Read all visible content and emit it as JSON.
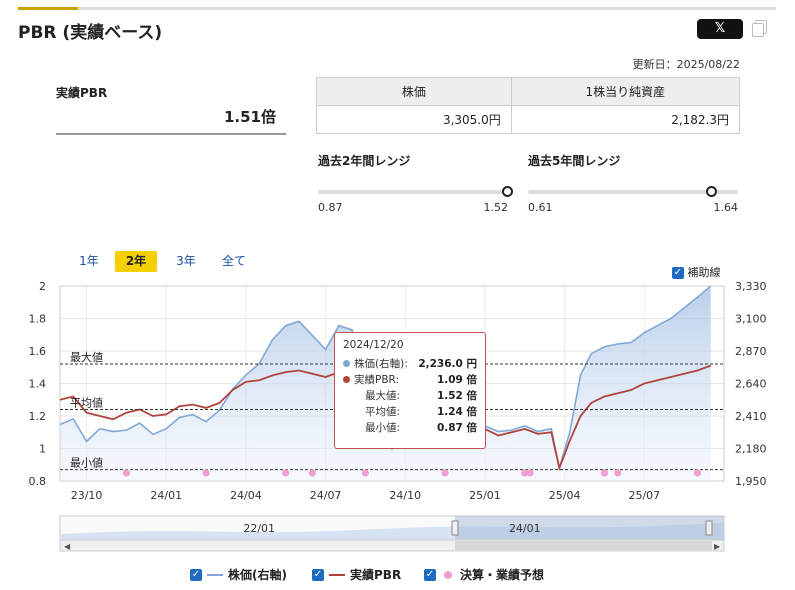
{
  "header": {
    "title": "PBR (実績ベース)",
    "share_label": "𝕏",
    "updated": "更新日：2025/08/22"
  },
  "pbr": {
    "label": "実績PBR",
    "value": "1.51倍"
  },
  "info_table": {
    "price_label": "株価",
    "bps_label": "1株当り純資産",
    "price_value": "3,305.0円",
    "bps_value": "2,182.3円"
  },
  "ranges": [
    {
      "title": "過去2年間レンジ",
      "min": "0.87",
      "max": "1.52",
      "position": 0.995
    },
    {
      "title": "過去5年間レンジ",
      "min": "0.61",
      "max": "1.64",
      "position": 0.87
    }
  ],
  "period_tabs": [
    {
      "label": "1年",
      "active": false
    },
    {
      "label": "2年",
      "active": true
    },
    {
      "label": "3年",
      "active": false
    },
    {
      "label": "全て",
      "active": false
    }
  ],
  "aux_label": "補助線",
  "colors": {
    "price": "#7fa8d8",
    "pbr": "#b0443c",
    "events": "#f0a0d0",
    "accent": "#f5d000",
    "checkbox": "#1e6bc1"
  },
  "chart_data": {
    "type": "line",
    "y_left": {
      "range": [
        0.8,
        2.0
      ],
      "ticks": [
        "0.8",
        "1",
        "1.2",
        "1.4",
        "1.6",
        "1.8",
        "2"
      ]
    },
    "y_right": {
      "range": [
        1950,
        3330
      ],
      "ticks": [
        "1,950",
        "2,180",
        "2,410",
        "2,640",
        "2,870",
        "3,100",
        "3,330"
      ]
    },
    "x_range": [
      0,
      25
    ],
    "x_ticks": [
      {
        "label": "23/10",
        "x": 1
      },
      {
        "label": "24/01",
        "x": 4
      },
      {
        "label": "24/04",
        "x": 7
      },
      {
        "label": "24/07",
        "x": 10
      },
      {
        "label": "24/10",
        "x": 13
      },
      {
        "label": "25/01",
        "x": 16
      },
      {
        "label": "25/04",
        "x": 19
      },
      {
        "label": "25/07",
        "x": 22
      }
    ],
    "reference_lines": [
      {
        "label": "最大値",
        "value": 1.52
      },
      {
        "label": "平均値",
        "value": 1.24
      },
      {
        "label": "最小値",
        "value": 0.87
      }
    ],
    "price_series": [
      [
        0,
        2350
      ],
      [
        0.5,
        2390
      ],
      [
        1,
        2230
      ],
      [
        1.5,
        2320
      ],
      [
        2,
        2300
      ],
      [
        2.5,
        2310
      ],
      [
        3,
        2360
      ],
      [
        3.5,
        2280
      ],
      [
        4,
        2320
      ],
      [
        4.5,
        2400
      ],
      [
        5,
        2420
      ],
      [
        5.5,
        2370
      ],
      [
        6,
        2450
      ],
      [
        6.5,
        2600
      ],
      [
        7,
        2700
      ],
      [
        7.5,
        2780
      ],
      [
        8,
        2950
      ],
      [
        8.5,
        3050
      ],
      [
        9,
        3080
      ],
      [
        9.5,
        2980
      ],
      [
        10,
        2880
      ],
      [
        10.5,
        3050
      ],
      [
        11,
        3020
      ],
      [
        11.5,
        2500
      ],
      [
        12,
        2260
      ],
      [
        12.5,
        2200
      ],
      [
        13,
        2270
      ],
      [
        13.5,
        2250
      ],
      [
        14,
        2300
      ],
      [
        14.5,
        2320
      ],
      [
        15,
        2350
      ],
      [
        15.5,
        2310
      ],
      [
        16,
        2340
      ],
      [
        16.5,
        2300
      ],
      [
        17,
        2310
      ],
      [
        17.5,
        2340
      ],
      [
        18,
        2300
      ],
      [
        18.5,
        2320
      ],
      [
        18.8,
        2040
      ],
      [
        19.2,
        2300
      ],
      [
        19.6,
        2700
      ],
      [
        20,
        2850
      ],
      [
        20.5,
        2900
      ],
      [
        21,
        2920
      ],
      [
        21.5,
        2930
      ],
      [
        22,
        3000
      ],
      [
        22.5,
        3050
      ],
      [
        23,
        3100
      ],
      [
        24,
        3250
      ],
      [
        24.5,
        3330
      ]
    ],
    "pbr_series": [
      [
        0,
        1.3
      ],
      [
        0.5,
        1.32
      ],
      [
        1,
        1.22
      ],
      [
        1.5,
        1.2
      ],
      [
        2,
        1.18
      ],
      [
        2.5,
        1.22
      ],
      [
        3,
        1.24
      ],
      [
        3.5,
        1.2
      ],
      [
        4,
        1.21
      ],
      [
        4.5,
        1.26
      ],
      [
        5,
        1.27
      ],
      [
        5.5,
        1.25
      ],
      [
        6,
        1.28
      ],
      [
        6.5,
        1.36
      ],
      [
        7,
        1.41
      ],
      [
        7.5,
        1.42
      ],
      [
        8,
        1.45
      ],
      [
        8.5,
        1.47
      ],
      [
        9,
        1.48
      ],
      [
        9.5,
        1.46
      ],
      [
        10,
        1.44
      ],
      [
        10.5,
        1.47
      ],
      [
        11,
        1.46
      ],
      [
        11.5,
        1.15
      ],
      [
        12,
        1.02
      ],
      [
        12.5,
        1.0
      ],
      [
        13,
        1.05
      ],
      [
        13.5,
        1.03
      ],
      [
        14,
        1.07
      ],
      [
        14.5,
        1.1
      ],
      [
        15,
        1.11
      ],
      [
        15.5,
        1.09
      ],
      [
        16,
        1.12
      ],
      [
        16.5,
        1.08
      ],
      [
        17,
        1.1
      ],
      [
        17.5,
        1.12
      ],
      [
        18,
        1.09
      ],
      [
        18.5,
        1.1
      ],
      [
        18.8,
        0.88
      ],
      [
        19.2,
        1.05
      ],
      [
        19.6,
        1.2
      ],
      [
        20,
        1.28
      ],
      [
        20.5,
        1.32
      ],
      [
        21,
        1.34
      ],
      [
        21.5,
        1.36
      ],
      [
        22,
        1.4
      ],
      [
        22.5,
        1.42
      ],
      [
        23,
        1.44
      ],
      [
        24,
        1.48
      ],
      [
        24.5,
        1.51
      ]
    ],
    "events": [
      2.5,
      5.5,
      8.5,
      9.5,
      11.5,
      14.5,
      17.5,
      17.7,
      20.5,
      21,
      24
    ],
    "tooltip": {
      "date": "2024/12/20",
      "price_label": "株価(右軸):",
      "price_value": "2,236.0 円",
      "pbr_label": "実績PBR:",
      "pbr_value": "1.09 倍",
      "max_label": "最大値:",
      "max_value": "1.52 倍",
      "avg_label": "平均値:",
      "avg_value": "1.24 倍",
      "min_label": "最小値:",
      "min_value": "0.87 倍"
    },
    "navigator_labels": [
      {
        "label": "22/01",
        "x": 0.3
      },
      {
        "label": "24/01",
        "x": 0.7
      }
    ]
  },
  "legend": {
    "price": "株価(右軸)",
    "pbr": "実績PBR",
    "events": "決算・業績予想"
  }
}
